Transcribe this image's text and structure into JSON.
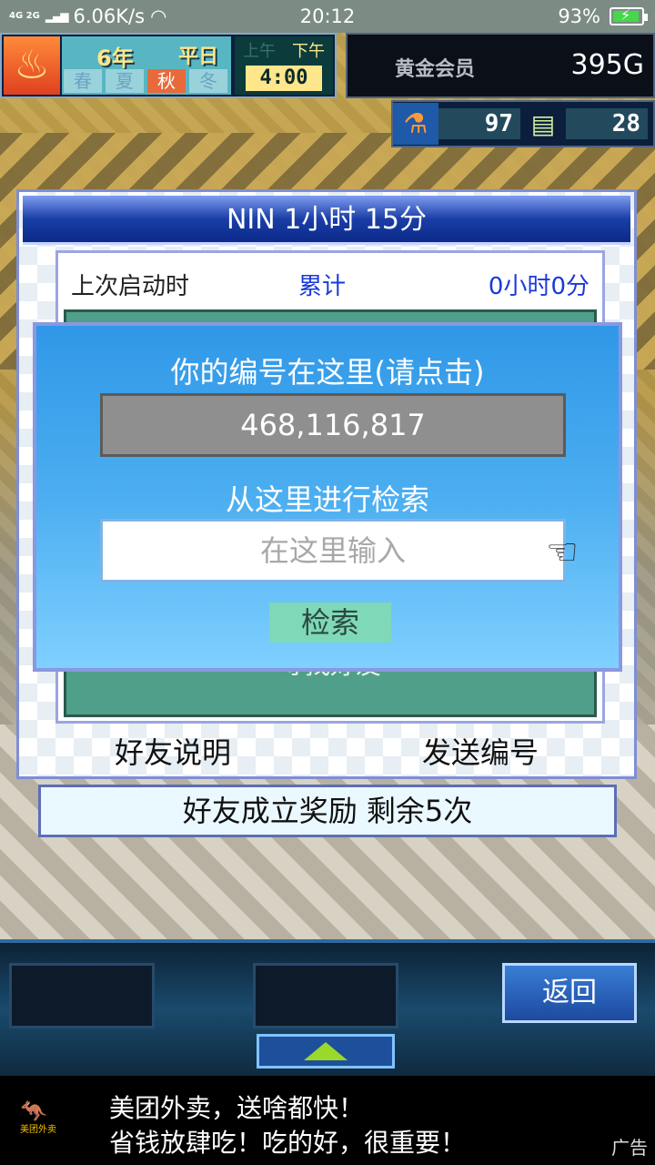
{
  "status_bar": {
    "network": "4G 2G",
    "speed": "6.06K/s",
    "time": "20:12",
    "battery": "93%",
    "battery_level": 0.93
  },
  "hud": {
    "year": "6年",
    "day": "平日",
    "seasons": [
      "春",
      "夏",
      "秋",
      "冬"
    ],
    "active_season": "秋",
    "am": "上午",
    "pm": "下午",
    "clock": "4:00",
    "membership": "黄金会员",
    "gold": "395G",
    "research": "97",
    "tickets": "28"
  },
  "panel": {
    "title": "NIN  1小时 15分",
    "last_launch_label": "上次启动时",
    "cumulative_label": "累计",
    "cumulative_time": "0小时0分",
    "find_friend": "寻找好友",
    "friend_info": "好友说明",
    "send_id": "发送编号",
    "reward": "好友成立奖励  剩余5次"
  },
  "modal": {
    "title": "你的编号在这里(请点击)",
    "my_number": "468,116,817",
    "search_title": "从这里进行检索",
    "search_placeholder": "在这里输入",
    "search_button": "检索"
  },
  "gamebar": {
    "back": "返回"
  },
  "ad": {
    "brand": "美团外卖",
    "line1": "美团外卖，送啥都快！",
    "line2": "省钱放肆吃！吃的好，很重要！",
    "tag": "广告"
  }
}
